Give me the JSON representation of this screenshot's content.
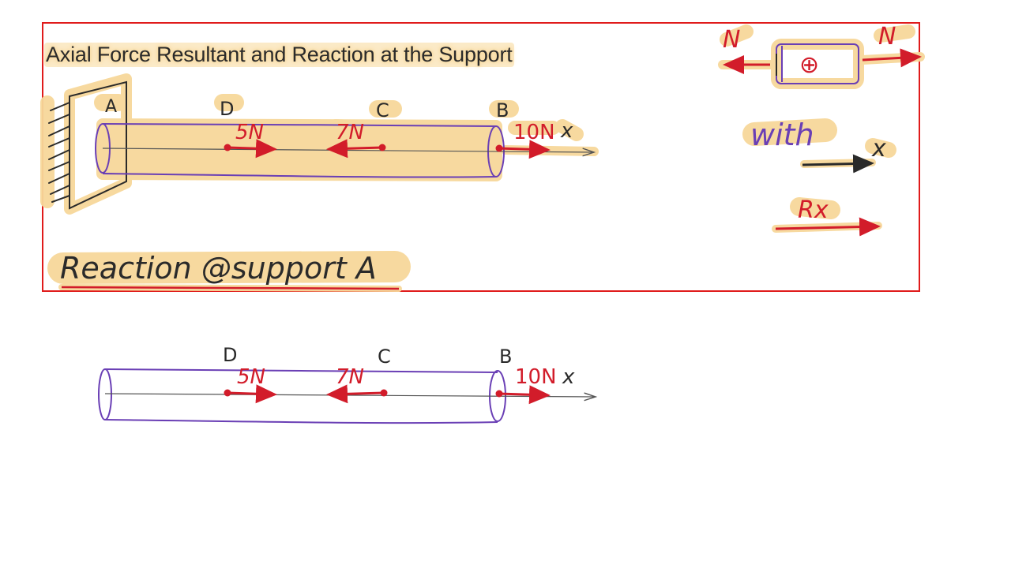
{
  "title": "Axial Force Resultant and Reaction at the Support",
  "labels": {
    "A": "A",
    "D": "D",
    "C": "C",
    "B": "B",
    "f5": "5N",
    "f7": "7N",
    "f10": "10N",
    "x": "x",
    "N_left": "N",
    "N_right": "N",
    "plus": "⊕",
    "with": "with",
    "x2": "x",
    "Rx": "Rx",
    "reaction": "Reaction @support A"
  },
  "colors": {
    "frame": "#e01b1b",
    "highlight": "#f7d89a",
    "force": "#d21c2a",
    "bar": "#6a3fb5",
    "ink": "#2a2a2a"
  }
}
